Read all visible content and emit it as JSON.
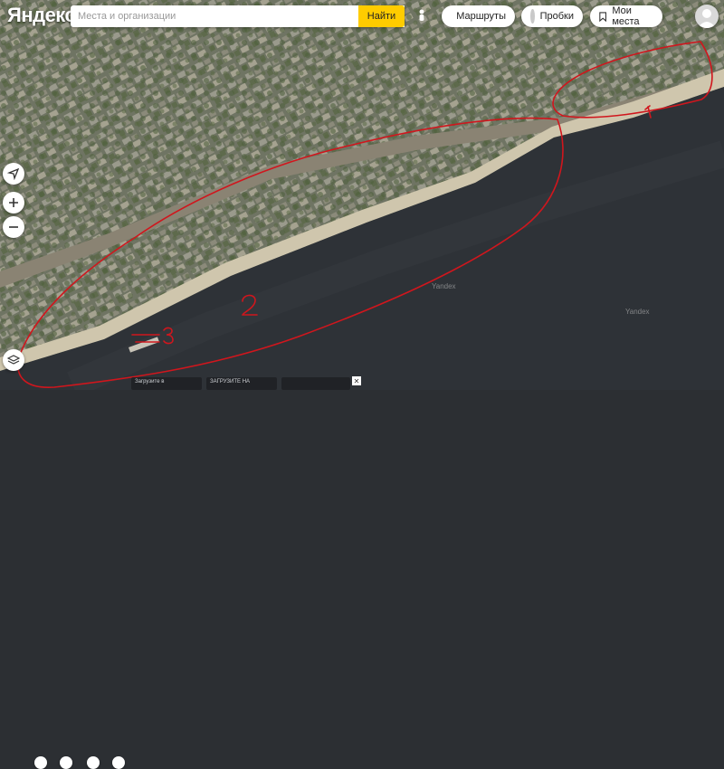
{
  "header": {
    "logo_text": "Яндекс",
    "search_placeholder": "Места и организации",
    "search_value": "",
    "find_label": "Найти",
    "routes_label": "Маршруты",
    "traffic_label": "Пробки",
    "my_places_label": "Мои места"
  },
  "map": {
    "watermarks": [
      "Yandex",
      "Yandex"
    ],
    "annotations": [
      "1",
      "2",
      "3"
    ],
    "annotation_color": "#d0161d",
    "river_color": "#2e3237",
    "embankment_color": "#cfc6ad",
    "city_color": "#7a7d6b"
  },
  "left_controls": {
    "icons": [
      "navigation-arrow-icon",
      "zoom-in-icon",
      "zoom-out-icon",
      "layers-icon"
    ]
  },
  "bottom": {
    "chip1_text": "Загрузите в",
    "chip2_text": "ЗАГРУЗИТЕ НА",
    "chip3_text": "",
    "close_symbol": "✕"
  }
}
